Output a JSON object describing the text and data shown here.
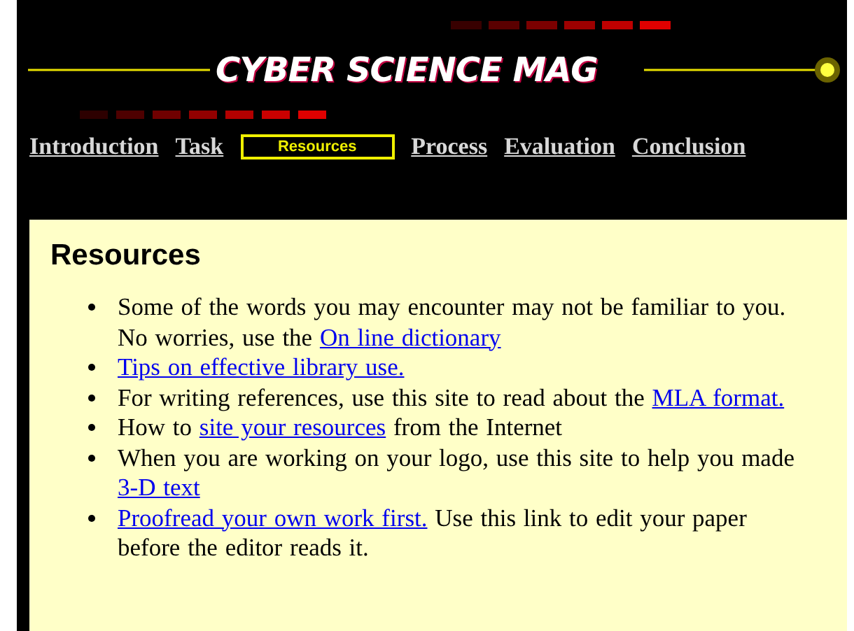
{
  "header": {
    "logo": "CYBER SCIENCE MAG"
  },
  "nav": [
    {
      "label": "Introduction",
      "selected": false
    },
    {
      "label": "Task",
      "selected": false
    },
    {
      "label": "Resources",
      "selected": true
    },
    {
      "label": "Process",
      "selected": false
    },
    {
      "label": "Evaluation",
      "selected": false
    },
    {
      "label": "Conclusion",
      "selected": false
    }
  ],
  "heading": "Resources",
  "items": [
    [
      {
        "text": "Some of the words you may encounter may not be familiar to you. No worries, use the ",
        "link": false
      },
      {
        "text": "On line dictionary",
        "link": true
      }
    ],
    [
      {
        "text": "Tips on effective library use.",
        "link": true
      }
    ],
    [
      {
        "text": "For writing references, use this site to read about the ",
        "link": false
      },
      {
        "text": "MLA format.",
        "link": true
      }
    ],
    [
      {
        "text": "How to ",
        "link": false
      },
      {
        "text": "site your resources",
        "link": true
      },
      {
        "text": " from the Internet",
        "link": false
      }
    ],
    [
      {
        "text": "When you are working on your logo, use this site to help you made ",
        "link": false
      },
      {
        "text": "3-D text",
        "link": true
      }
    ],
    [
      {
        "text": "Proofread your own work first.",
        "link": true
      },
      {
        "text": " Use this link to edit your paper before the editor reads it.",
        "link": false
      }
    ]
  ]
}
